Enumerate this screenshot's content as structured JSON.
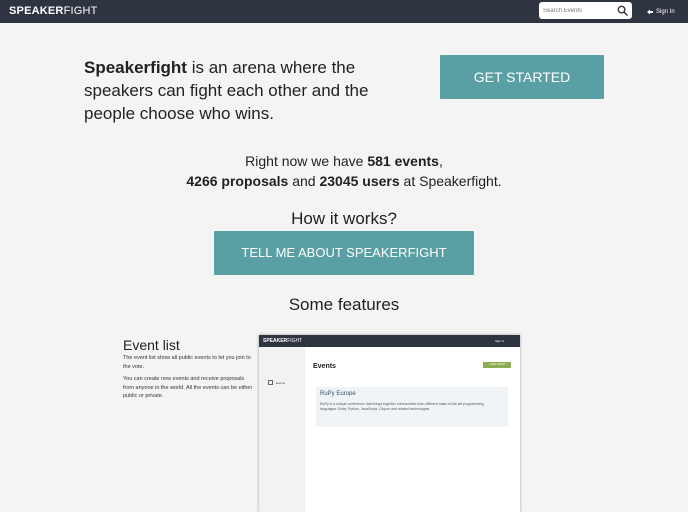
{
  "navbar": {
    "logo_bold": "SPEAKER",
    "logo_rest": "FIGHT",
    "search_placeholder": "Search Events",
    "search_icon": "search-icon",
    "signin_label": "Sign In",
    "signin_icon": "signin-icon",
    "bg_color": "#2f3441"
  },
  "hero": {
    "brand": "Speakerfight",
    "tagline": " is an arena where the speakers can fight each other and the people choose who wins.",
    "cta_label": "GET STARTED",
    "accent_color": "#5a9fa3"
  },
  "stats": {
    "prefix": "Right now we have ",
    "events": "581 events",
    "comma": ",",
    "proposals": "4266 proposals",
    "and": " and ",
    "users": "23045 users",
    "suffix": " at Speakerfight."
  },
  "how_it_works": {
    "heading": "How it works?",
    "button_label": "TELL ME ABOUT SPEAKERFIGHT"
  },
  "features": {
    "heading": "Some features",
    "items": [
      {
        "title": "Event list",
        "desc1": "The event list show all public events to let you join to the vote.",
        "desc2": "You can create new events and receive proposals from anyone in the world. All the events can be either public or private."
      }
    ]
  },
  "mini_screenshot": {
    "logo_bold": "SPEAKER",
    "logo_rest": "FIGHT",
    "signin": "Sign In",
    "side_label": "Events",
    "title": "Events",
    "add_button": "+ ADD EVENT",
    "card_title": "RuPy Europe",
    "card_desc": "RuPy is a unique conference that brings together communities from different state-of-the-art programming languages: Ruby, Python, JavaScript, Clojure and related technologies."
  }
}
